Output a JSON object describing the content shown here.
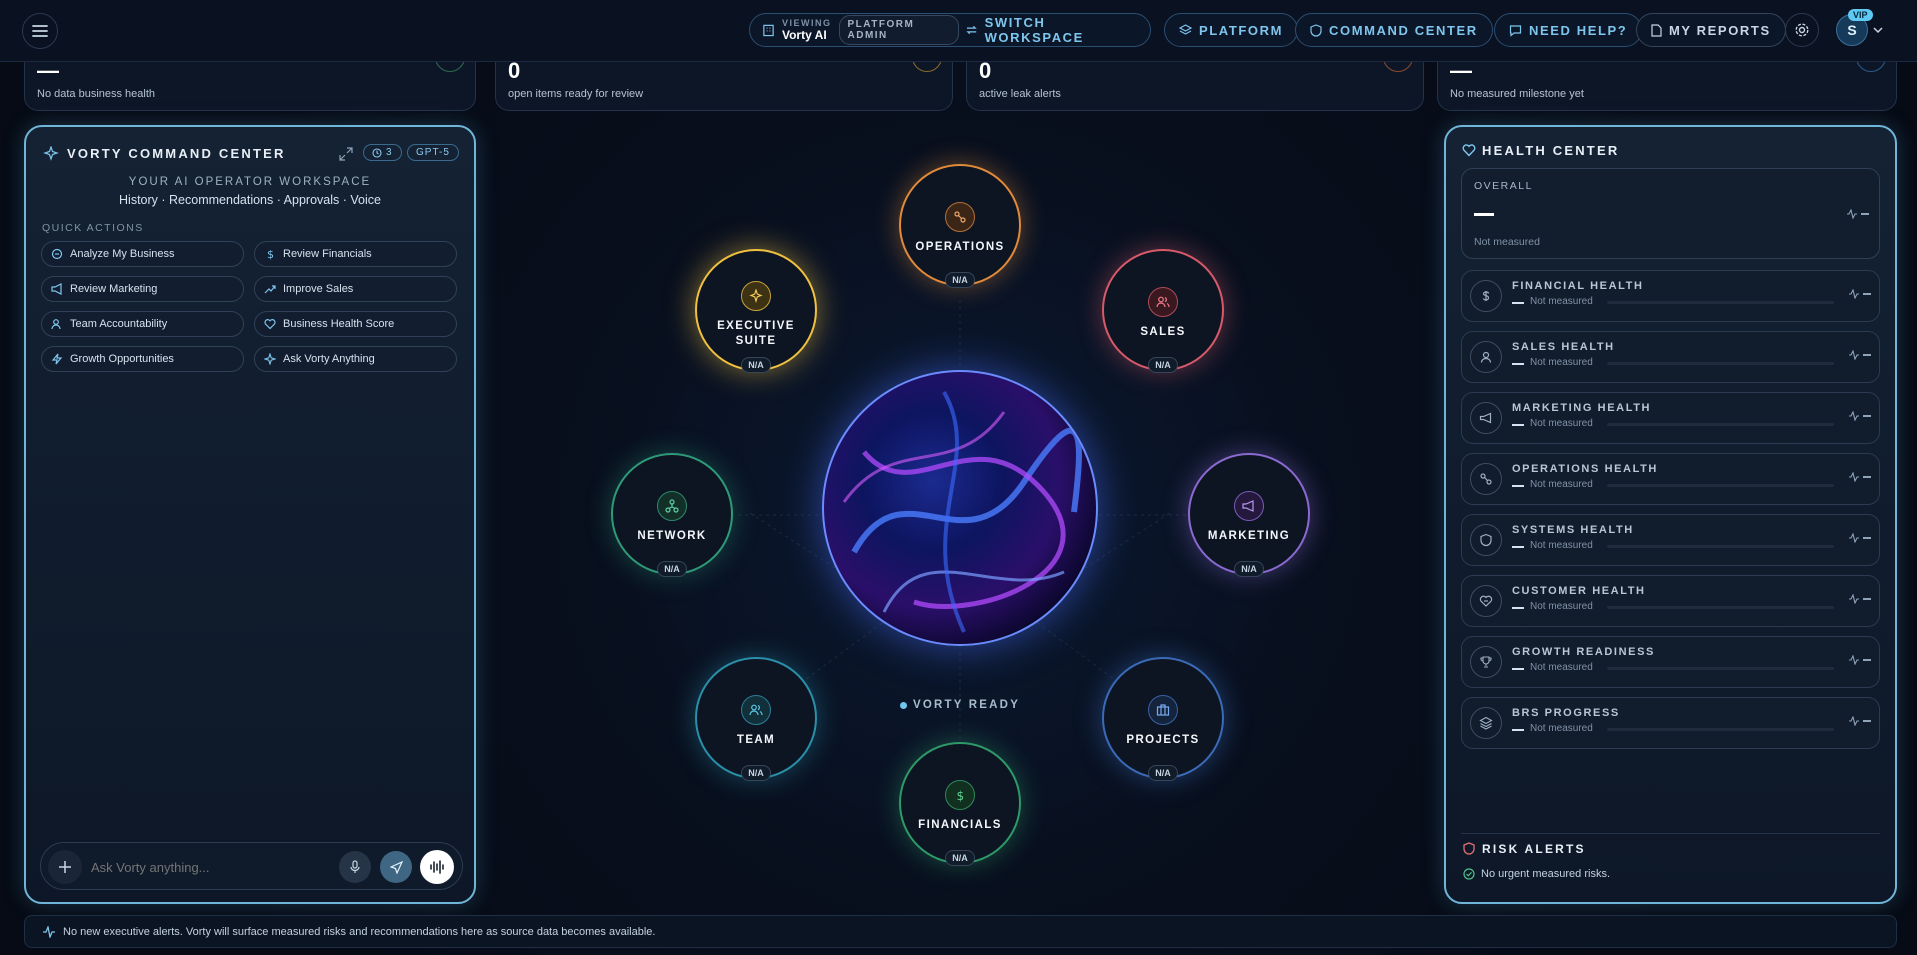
{
  "topbar": {
    "viewing_label": "VIEWING",
    "workspace": "Vorty AI",
    "admin_badge": "PLATFORM ADMIN",
    "switch": "SWITCH WORKSPACE",
    "platform": "PLATFORM",
    "command": "COMMAND CENTER",
    "help": "NEED HELP?",
    "reports": "MY REPORTS",
    "avatar": "S",
    "vip": "VIP"
  },
  "stats": [
    {
      "value": "—",
      "label": "No data business health"
    },
    {
      "value": "0",
      "label": "open items ready for review"
    },
    {
      "value": "0",
      "label": "active leak alerts"
    },
    {
      "value": "—",
      "label": "No measured milestone yet"
    }
  ],
  "left": {
    "title": "VORTY COMMAND CENTER",
    "history_count": "3",
    "model": "GPT-5",
    "subtitle": "YOUR AI OPERATOR WORKSPACE",
    "tagline": "History · Recommendations · Approvals · Voice",
    "qa_title": "QUICK ACTIONS",
    "actions": [
      "Analyze My Business",
      "Review Financials",
      "Review Marketing",
      "Improve Sales",
      "Team Accountability",
      "Business Health Score",
      "Growth Opportunities",
      "Ask Vorty Anything"
    ],
    "input_placeholder": "Ask Vorty anything..."
  },
  "orbit": {
    "status": "VORTY READY",
    "nodes": [
      {
        "label": "OPERATIONS",
        "value": "N/A"
      },
      {
        "label": "EXECUTIVE SUITE",
        "value": "N/A"
      },
      {
        "label": "SALES",
        "value": "N/A"
      },
      {
        "label": "NETWORK",
        "value": "N/A"
      },
      {
        "label": "MARKETING",
        "value": "N/A"
      },
      {
        "label": "TEAM",
        "value": "N/A"
      },
      {
        "label": "PROJECTS",
        "value": "N/A"
      },
      {
        "label": "FINANCIALS",
        "value": "N/A"
      }
    ]
  },
  "health": {
    "title": "HEALTH CENTER",
    "overall_label": "OVERALL",
    "overall_value": "—",
    "overall_sub": "Not measured",
    "rows": [
      {
        "name": "FINANCIAL HEALTH",
        "sub": "Not measured"
      },
      {
        "name": "SALES HEALTH",
        "sub": "Not measured"
      },
      {
        "name": "MARKETING HEALTH",
        "sub": "Not measured"
      },
      {
        "name": "OPERATIONS HEALTH",
        "sub": "Not measured"
      },
      {
        "name": "SYSTEMS HEALTH",
        "sub": "Not measured"
      },
      {
        "name": "CUSTOMER HEALTH",
        "sub": "Not measured"
      },
      {
        "name": "GROWTH READINESS",
        "sub": "Not measured"
      },
      {
        "name": "BRS PROGRESS",
        "sub": "Not measured"
      }
    ],
    "risk_title": "RISK ALERTS",
    "risk_text": "No urgent measured risks."
  },
  "bottom": {
    "text": "No new executive alerts. Vorty will surface measured risks and recommendations here as source data becomes available."
  }
}
